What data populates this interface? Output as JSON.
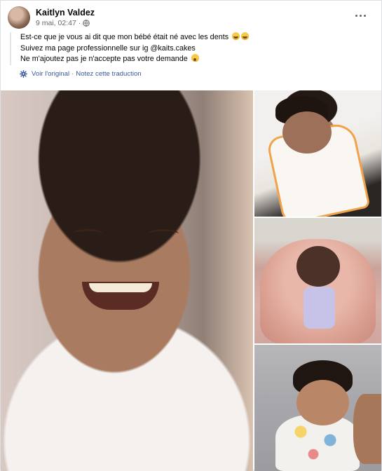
{
  "post": {
    "author": "Kaitlyn Valdez",
    "date": "9 mai, 02:47",
    "separator": "·",
    "audience_icon": "globe-icon",
    "more_icon": "more-horizontal-icon",
    "text_lines": [
      "Est-ce que je vous ai dit que mon bébé était né avec les dents",
      "Suivez ma page professionnelle sur ig @kaits.cakes",
      "Ne m'ajoutez pas je n'accepte pas votre demande"
    ],
    "emojis": {
      "line1": [
        "grinning-sweat-emoji",
        "grinning-sweat-emoji"
      ],
      "line3": [
        "screaming-face-emoji"
      ]
    },
    "translation": {
      "icon": "gear-icon",
      "see_original": "Voir l'original",
      "separator": "·",
      "rate": "Notez cette traduction"
    }
  },
  "photos": [
    {
      "name": "baby-smiling-closeup"
    },
    {
      "name": "baby-in-orange-bib"
    },
    {
      "name": "baby-in-pink-jacket"
    },
    {
      "name": "baby-in-floral-onesie"
    }
  ],
  "colors": {
    "link": "#385898",
    "meta": "#65676b",
    "text": "#050505",
    "border": "#dddfe2"
  }
}
